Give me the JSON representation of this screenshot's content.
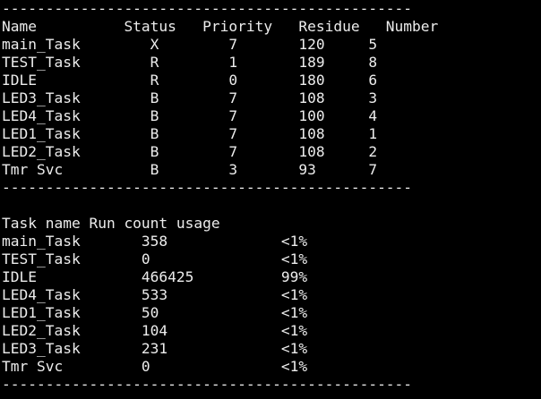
{
  "terminal": {
    "lines": [
      "-----------------------------------------------",
      "Name          Status   Priority   Residue   Number",
      "main_Task        X        7       120     5",
      "TEST_Task        R        1       189     8",
      "IDLE             R        0       180     6",
      "LED3_Task        B        7       108     3",
      "LED4_Task        B        7       100     4",
      "LED1_Task        B        7       108     1",
      "LED2_Task        B        7       108     2",
      "Tmr Svc          B        3       93      7",
      "-----------------------------------------------",
      "",
      "Task name Run count usage",
      "main_Task       358             <1%",
      "TEST_Task       0               <1%",
      "IDLE            466425          99%",
      "LED4_Task       533             <1%",
      "LED1_Task       50              <1%",
      "LED2_Task       104             <1%",
      "LED3_Task       231             <1%",
      "Tmr Svc         0               <1%",
      "-----------------------------------------------"
    ]
  }
}
